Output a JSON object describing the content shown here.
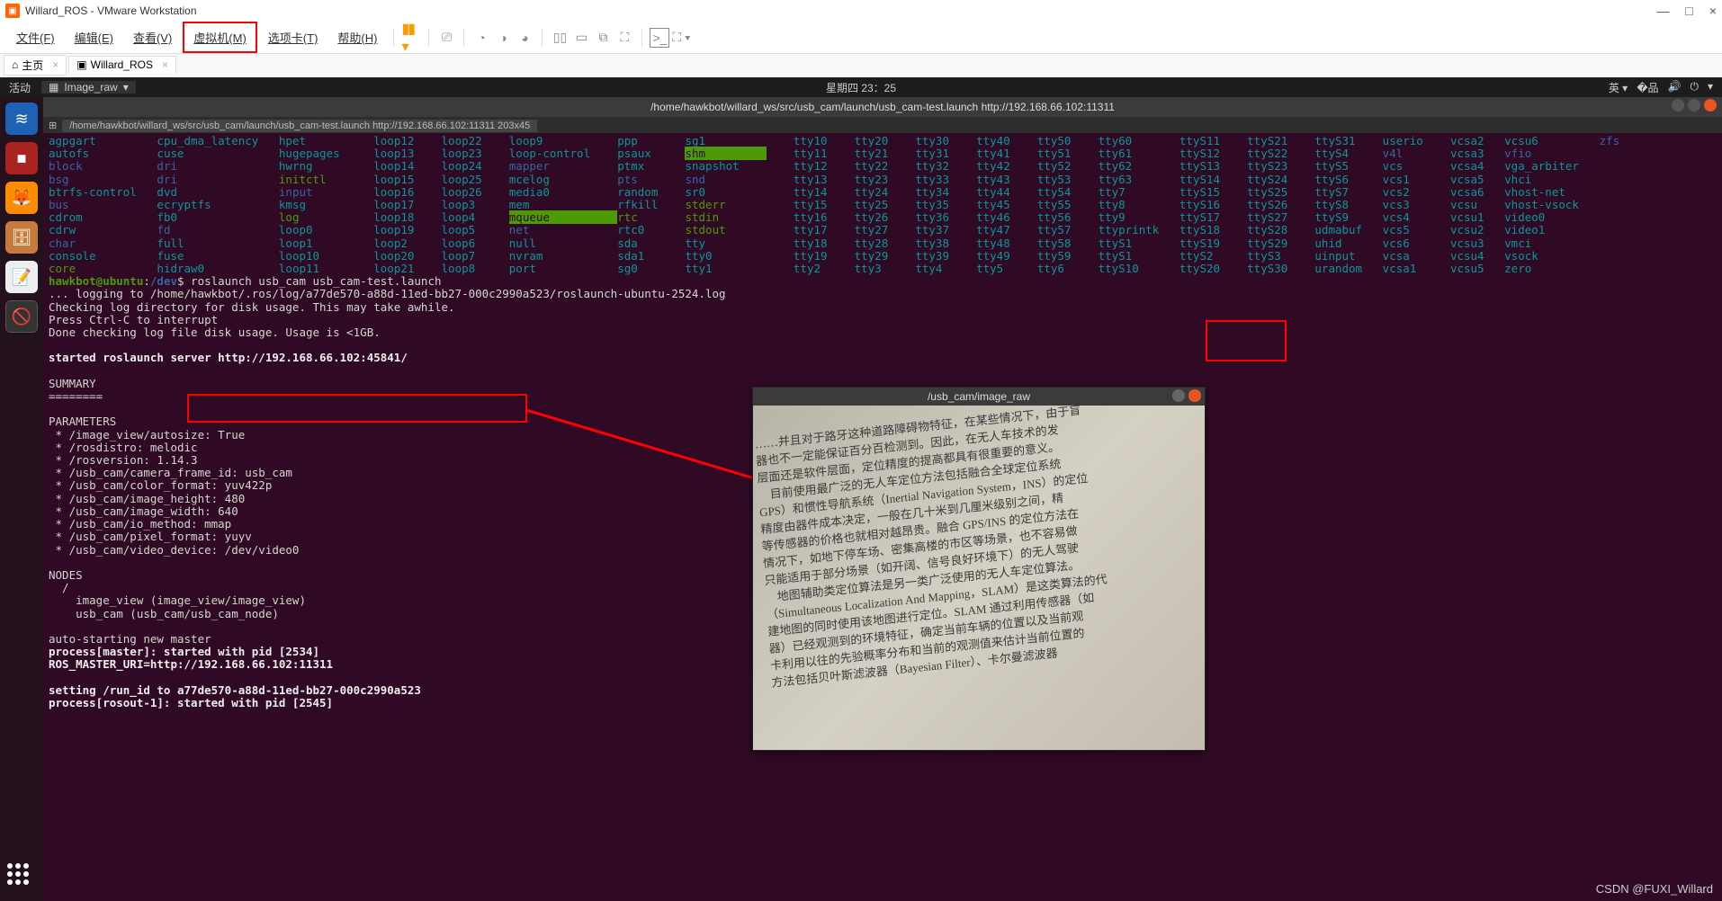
{
  "vmware": {
    "title": "Willard_ROS - VMware Workstation",
    "menu": {
      "file": "文件(F)",
      "edit": "编辑(E)",
      "view": "查看(V)",
      "vm": "虚拟机(M)",
      "tabs": "选项卡(T)",
      "help": "帮助(H)"
    },
    "host_tabs": {
      "home": "主页",
      "vm": "Willard_ROS"
    }
  },
  "gnome": {
    "activities": "活动",
    "app_combo": "Image_raw",
    "clock": "星期四 23：25",
    "lang": "英"
  },
  "term": {
    "title": "/home/hawkbot/willard_ws/src/usb_cam/launch/usb_cam-test.launch http://192.168.66.102:11311",
    "tab": "/home/hawkbot/willard_ws/src/usb_cam/launch/usb_cam-test.launch http://192.168.66.102:11311 203x45",
    "ls_rows": [
      [
        "agpgart",
        "cpu_dma_latency",
        "hpet",
        "loop12",
        "loop22",
        "loop9",
        "ppp",
        "sg1",
        "",
        "tty10",
        "tty20",
        "tty30",
        "tty40",
        "tty50",
        "tty60",
        "ttyS11",
        "ttyS21",
        "ttyS31",
        "userio",
        "vcsa2",
        "vcsu6",
        "zfs"
      ],
      [
        "autofs",
        "cuse",
        "hugepages",
        "loop13",
        "loop23",
        "loop-control",
        "psaux",
        "shm",
        "",
        "tty11",
        "tty21",
        "tty31",
        "tty41",
        "tty51",
        "tty61",
        "ttyS12",
        "ttyS22",
        "ttyS4",
        "v4l",
        "vcsa3",
        "vfio",
        ""
      ],
      [
        "block",
        "dri",
        "hwrng",
        "loop14",
        "loop24",
        "mapper",
        "ptmx",
        "snapshot",
        "",
        "tty12",
        "tty22",
        "tty32",
        "tty42",
        "tty52",
        "tty62",
        "ttyS13",
        "ttyS23",
        "ttyS5",
        "vcs",
        "vcsa4",
        "vga_arbiter",
        ""
      ],
      [
        "bsg",
        "dri",
        "initctl",
        "loop15",
        "loop25",
        "mcelog",
        "pts",
        "snd",
        "",
        "tty13",
        "tty23",
        "tty33",
        "tty43",
        "tty53",
        "tty63",
        "ttyS14",
        "ttyS24",
        "ttyS6",
        "vcs1",
        "vcsa5",
        "vhci",
        ""
      ],
      [
        "btrfs-control",
        "dvd",
        "input",
        "loop16",
        "loop26",
        "media0",
        "random",
        "sr0",
        "",
        "tty14",
        "tty24",
        "tty34",
        "tty44",
        "tty54",
        "tty7",
        "ttyS15",
        "ttyS25",
        "ttyS7",
        "vcs2",
        "vcsa6",
        "vhost-net",
        ""
      ],
      [
        "bus",
        "ecryptfs",
        "kmsg",
        "loop17",
        "loop3",
        "mem",
        "rfkill",
        "stderr",
        "",
        "tty15",
        "tty25",
        "tty35",
        "tty45",
        "tty55",
        "tty8",
        "ttyS16",
        "ttyS26",
        "ttyS8",
        "vcs3",
        "vcsu",
        "vhost-vsock",
        ""
      ],
      [
        "cdrom",
        "fb0",
        "log",
        "loop18",
        "loop4",
        "mqueue",
        "rtc",
        "stdin",
        "",
        "tty16",
        "tty26",
        "tty36",
        "tty46",
        "tty56",
        "tty9",
        "ttyS17",
        "ttyS27",
        "ttyS9",
        "vcs4",
        "vcsu1",
        "video0",
        ""
      ],
      [
        "cdrw",
        "fd",
        "loop0",
        "loop19",
        "loop5",
        "net",
        "rtc0",
        "stdout",
        "",
        "tty17",
        "tty27",
        "tty37",
        "tty47",
        "tty57",
        "ttyprintk",
        "ttyS18",
        "ttyS28",
        "udmabuf",
        "vcs5",
        "vcsu2",
        "video1",
        ""
      ],
      [
        "char",
        "full",
        "loop1",
        "loop2",
        "loop6",
        "null",
        "sda",
        "tty",
        "",
        "tty18",
        "tty28",
        "tty38",
        "tty48",
        "tty58",
        "ttyS1",
        "ttyS19",
        "ttyS29",
        "uhid",
        "vcs6",
        "vcsu3",
        "vmci",
        ""
      ],
      [
        "console",
        "fuse",
        "loop10",
        "loop20",
        "loop7",
        "nvram",
        "sda1",
        "tty0",
        "",
        "tty19",
        "tty29",
        "tty39",
        "tty49",
        "tty59",
        "ttyS1",
        "ttyS2",
        "ttyS3",
        "uinput",
        "vcsa",
        "vcsu4",
        "vsock",
        ""
      ],
      [
        "core",
        "hidraw0",
        "loop11",
        "loop21",
        "loop8",
        "port",
        "sg0",
        "tty1",
        "",
        "tty2",
        "tty3",
        "tty4",
        "tty5",
        "tty6",
        "ttyS10",
        "ttyS20",
        "ttyS30",
        "urandom",
        "vcsa1",
        "vcsu5",
        "zero",
        ""
      ]
    ],
    "ls_colors": {
      "cyan": [
        "agpgart",
        "autofs",
        "btrfs-control",
        "cdrom",
        "cdrw",
        "console",
        "cuse",
        "dvd",
        "ecryptfs",
        "fb0",
        "fuse",
        "hidraw0",
        "cpu_dma_latency",
        "hpet",
        "hugepages",
        "hwrng",
        "kmsg",
        "full",
        "mcelog",
        "media0",
        "mem",
        "nvram",
        "port",
        "ppp",
        "psaux",
        "ptmx",
        "random",
        "rfkill",
        "rtc0",
        "sg0",
        "sg1",
        "snapshot",
        "tty",
        "tty0",
        "tty1",
        "tty10",
        "tty11",
        "tty12",
        "tty13",
        "tty14",
        "tty15",
        "tty16",
        "tty17",
        "tty18",
        "tty19",
        "tty2",
        "tty20",
        "tty21",
        "tty22",
        "tty23",
        "tty24",
        "tty25",
        "tty26",
        "tty27",
        "tty28",
        "tty29",
        "tty3",
        "tty30",
        "tty31",
        "tty32",
        "tty33",
        "tty34",
        "tty35",
        "tty36",
        "tty37",
        "tty38",
        "tty39",
        "tty4",
        "tty40",
        "tty41",
        "tty42",
        "tty43",
        "tty44",
        "tty45",
        "tty46",
        "tty47",
        "tty48",
        "tty49",
        "tty5",
        "tty50",
        "tty51",
        "tty52",
        "tty53",
        "tty54",
        "tty55",
        "tty56",
        "tty57",
        "tty58",
        "tty59",
        "tty6",
        "tty60",
        "tty61",
        "tty62",
        "tty63",
        "tty7",
        "tty8",
        "tty9",
        "ttyprintk",
        "ttyS1",
        "ttyS10",
        "ttyS11",
        "ttyS12",
        "ttyS13",
        "ttyS14",
        "ttyS15",
        "ttyS16",
        "ttyS17",
        "ttyS18",
        "ttyS19",
        "ttyS2",
        "ttyS20",
        "ttyS21",
        "ttyS22",
        "ttyS23",
        "ttyS24",
        "ttyS25",
        "ttyS26",
        "ttyS27",
        "ttyS28",
        "ttyS29",
        "ttyS3",
        "ttyS30",
        "ttyS31",
        "ttyS4",
        "ttyS5",
        "ttyS6",
        "ttyS7",
        "ttyS8",
        "ttyS9",
        "udmabuf",
        "uhid",
        "uinput",
        "urandom",
        "userio",
        "vcs",
        "vcs1",
        "vcs2",
        "vcs3",
        "vcs4",
        "vcs5",
        "vcs6",
        "vcsa",
        "vcsa1",
        "vcsa2",
        "vcsa3",
        "vcsa4",
        "vcsa5",
        "vcsa6",
        "vcsu",
        "vcsu1",
        "vcsu2",
        "vcsu3",
        "vcsu4",
        "vcsu5",
        "vcsu6",
        "vga_arbiter",
        "vhci",
        "vhost-net",
        "vhost-vsock",
        "vmci",
        "vsock",
        "zero",
        "loop-control",
        "loop0",
        "loop1",
        "loop10",
        "loop11",
        "loop12",
        "loop13",
        "loop14",
        "loop15",
        "loop16",
        "loop17",
        "loop18",
        "loop19",
        "loop2",
        "loop20",
        "loop21",
        "loop22",
        "loop23",
        "loop24",
        "loop25",
        "loop26",
        "loop3",
        "loop4",
        "loop5",
        "loop6",
        "loop7",
        "loop8",
        "loop9",
        "null",
        "sda",
        "sda1",
        "sr0",
        "video0",
        "video1"
      ],
      "blue": [
        "block",
        "bsg",
        "bus",
        "char",
        "dri",
        "input",
        "mapper",
        "net",
        "pts",
        "snd",
        "v4l",
        "vfio",
        "fd",
        "zfs"
      ],
      "green": [
        "core",
        "initctl",
        "log",
        "rtc",
        "stderr",
        "stdin",
        "stdout"
      ],
      "bg_green": [
        "shm",
        "mqueue"
      ]
    },
    "prompt": {
      "user": "hawkbot",
      "host": "ubuntu",
      "path": "/dev",
      "cmd": "roslaunch usb_cam usb_cam-test.launch"
    },
    "lines": [
      "... logging to /home/hawkbot/.ros/log/a77de570-a88d-11ed-bb27-000c2990a523/roslaunch-ubuntu-2524.log",
      "Checking log directory for disk usage. This may take awhile.",
      "Press Ctrl-C to interrupt",
      "Done checking log file disk usage. Usage is <1GB.",
      "",
      "started roslaunch server http://192.168.66.102:45841/",
      "",
      "SUMMARY",
      "========",
      "",
      "PARAMETERS",
      " * /image_view/autosize: True",
      " * /rosdistro: melodic",
      " * /rosversion: 1.14.3",
      " * /usb_cam/camera_frame_id: usb_cam",
      " * /usb_cam/color_format: yuv422p",
      " * /usb_cam/image_height: 480",
      " * /usb_cam/image_width: 640",
      " * /usb_cam/io_method: mmap",
      " * /usb_cam/pixel_format: yuyv",
      " * /usb_cam/video_device: /dev/video0",
      "",
      "NODES",
      "  /",
      "    image_view (image_view/image_view)",
      "    usb_cam (usb_cam/usb_cam_node)",
      "",
      "auto-starting new master",
      "process[master]: started with pid [2534]",
      "ROS_MASTER_URI=http://192.168.66.102:11311",
      "",
      "setting /run_id to a77de570-a88d-11ed-bb27-000c2990a523",
      "process[rosout-1]: started with pid [2545]"
    ],
    "bold_lines": [
      "started roslaunch server http://192.168.66.102:45841/",
      "process[master]: started with pid [2534]",
      "ROS_MASTER_URI=http://192.168.66.102:11311",
      "setting /run_id to a77de570-a88d-11ed-bb27-000c2990a523",
      "process[rosout-1]: started with pid [2545]"
    ]
  },
  "imgwin": {
    "title": "/usb_cam/image_raw",
    "paper": [
      "……并且对于路牙这种道路障碍物特征，在某些情况下，由于盲",
      "器也不一定能保证百分百检测到。因此，在无人车技术的发",
      "层面还是软件层面，定位精度的提高都具有很重要的意义。",
      "　目前使用最广泛的无人车定位方法包括融合全球定位系统",
      "GPS）和惯性导航系统（Inertial Navigation System，INS）的定位",
      "精度由器件成本决定，一般在几十米到几厘米级别之间，精",
      "等传感器的价格也就相对越昂贵。融合 GPS/INS 的定位方法在",
      "情况下，如地下停车场、密集高楼的市区等场景，也不容易做",
      "只能适用于部分场景（如开阔、信号良好环境下）的无人驾驶",
      "　地图辅助类定位算法是另一类广泛使用的无人车定位算法。",
      "（Simultaneous Localization And Mapping，SLAM）是这类算法的代",
      "建地图的同时使用该地图进行定位。SLAM 通过利用传感器（如",
      "器）已经观测到的环境特征，确定当前车辆的位置以及当前观",
      "卡利用以往的先验概率分布和当前的观测值来估计当前位置的",
      "方法包括贝叶斯滤波器（Bayesian Filter）、卡尔曼滤波器"
    ]
  },
  "watermark": "CSDN @FUXI_Willard"
}
